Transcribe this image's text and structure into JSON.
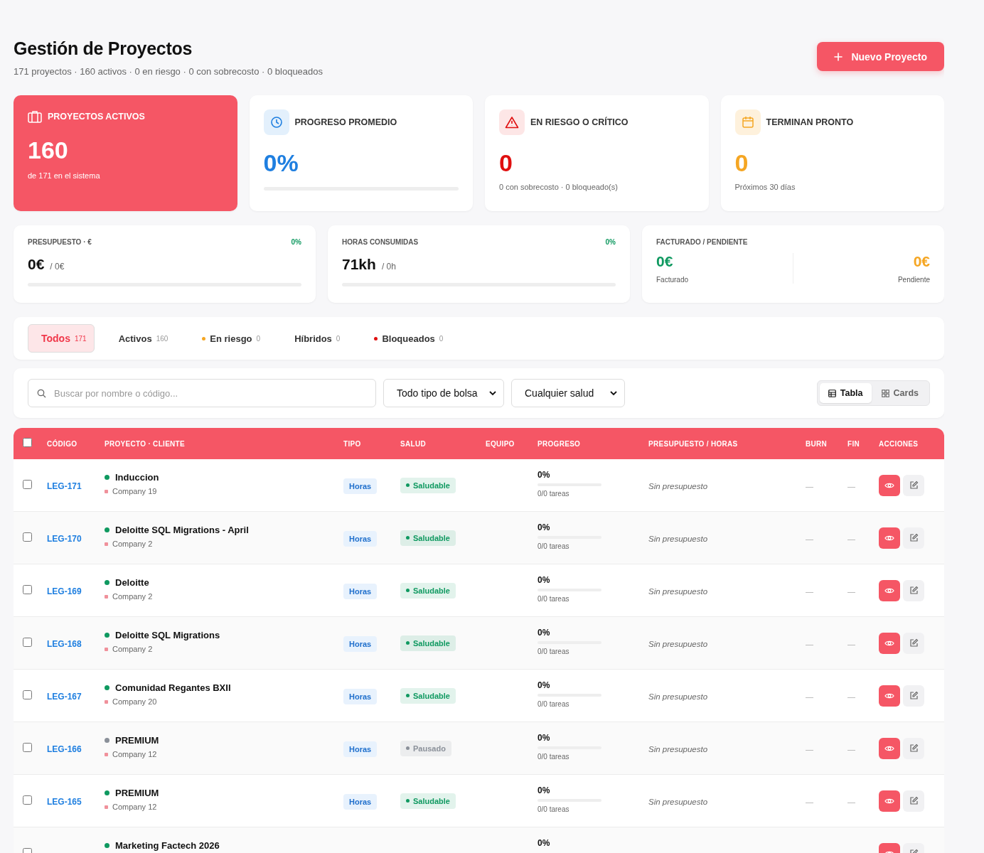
{
  "header": {
    "title": "Gestión de Proyectos",
    "subtitle": "171 proyectos · 160 activos · 0 en riesgo · 0 con sobrecosto · 0 bloqueados",
    "new_button": "Nuevo Proyecto"
  },
  "stat_cards": [
    {
      "kind": "primary",
      "label": "PROYECTOS ACTIVOS",
      "value": "160",
      "note": "de 171 en el sistema"
    },
    {
      "kind": "progress",
      "label": "PROGRESO PROMEDIO",
      "value": "0%",
      "level": 0
    },
    {
      "kind": "danger",
      "label": "EN RIESGO O CRÍTICO",
      "value": "0",
      "note": "0 con sobrecosto · 0 bloqueado(s)"
    },
    {
      "kind": "warning",
      "label": "TERMINAN PRONTO",
      "value": "0",
      "note": "Próximos 30 días"
    }
  ],
  "budget_cards": [
    {
      "kind": "meter",
      "label": "PRESUPUESTO · €",
      "percent": "0%",
      "value": "0€",
      "total": "/ 0€",
      "level": 0
    },
    {
      "kind": "meter",
      "label": "HORAS CONSUMIDAS",
      "percent": "0%",
      "value": "71kh",
      "total": "/ 0h",
      "level": 0
    },
    {
      "kind": "split",
      "label": "FACTURADO / PENDIENTE",
      "left_value": "0€",
      "left_label": "Facturado",
      "right_value": "0€",
      "right_label": "Pendiente"
    }
  ],
  "filter_tabs": [
    {
      "label": "Todos",
      "count": "171",
      "selected": true
    },
    {
      "label": "Activos",
      "count": "160",
      "selected": false
    },
    {
      "label": "En riesgo",
      "count": "0",
      "selected": false,
      "color": "#f5a623"
    },
    {
      "label": "Híbridos",
      "count": "0",
      "selected": false
    },
    {
      "label": "Bloqueados",
      "count": "0",
      "selected": false,
      "color": "#e01010"
    }
  ],
  "search": {
    "placeholder": "Buscar por nombre o código..."
  },
  "selects": [
    "Todo tipo de bolsa",
    "Cualquier salud"
  ],
  "view_toggle": [
    {
      "label": "Tabla",
      "selected": true
    },
    {
      "label": "Cards",
      "selected": false
    }
  ],
  "table": {
    "select_all_checked": false,
    "columns": [
      "CÓDIGO",
      "PROYECTO · CLIENTE",
      "TIPO",
      "SALUD",
      "EQUIPO",
      "PROGRESO",
      "PRESUPUESTO / HORAS",
      "BURN",
      "FIN",
      "ACCIONES"
    ],
    "rows": [
      {
        "checked": false,
        "code": "LEG-171",
        "name": "Induccion",
        "client": "Company 19",
        "type": "Horas",
        "health": "Saludable",
        "color": "#0f9960",
        "progress": "0%",
        "level": 0,
        "tasks": "0/0 tareas",
        "budget": "Sin presupuesto",
        "burn": "—",
        "end": "—"
      },
      {
        "checked": false,
        "code": "LEG-170",
        "name": "Deloitte SQL Migrations - April",
        "client": "Company 2",
        "type": "Horas",
        "health": "Saludable",
        "color": "#0f9960",
        "progress": "0%",
        "level": 0,
        "tasks": "0/0 tareas",
        "budget": "Sin presupuesto",
        "burn": "—",
        "end": "—"
      },
      {
        "checked": false,
        "code": "LEG-169",
        "name": "Deloitte",
        "client": "Company 2",
        "type": "Horas",
        "health": "Saludable",
        "color": "#0f9960",
        "progress": "0%",
        "level": 0,
        "tasks": "0/0 tareas",
        "budget": "Sin presupuesto",
        "burn": "—",
        "end": "—"
      },
      {
        "checked": false,
        "code": "LEG-168",
        "name": "Deloitte SQL Migrations",
        "client": "Company 2",
        "type": "Horas",
        "health": "Saludable",
        "color": "#0f9960",
        "progress": "0%",
        "level": 0,
        "tasks": "0/0 tareas",
        "budget": "Sin presupuesto",
        "burn": "—",
        "end": "—"
      },
      {
        "checked": false,
        "code": "LEG-167",
        "name": "Comunidad Regantes BXII",
        "client": "Company 20",
        "type": "Horas",
        "health": "Saludable",
        "color": "#0f9960",
        "progress": "0%",
        "level": 0,
        "tasks": "0/0 tareas",
        "budget": "Sin presupuesto",
        "burn": "—",
        "end": "—"
      },
      {
        "checked": false,
        "code": "LEG-166",
        "name": "PREMIUM",
        "client": "Company 12",
        "type": "Horas",
        "health": "Pausado",
        "color": "#8a9099",
        "progress": "0%",
        "level": 0,
        "tasks": "0/0 tareas",
        "budget": "Sin presupuesto",
        "burn": "—",
        "end": "—"
      },
      {
        "checked": false,
        "code": "LEG-165",
        "name": "PREMIUM",
        "client": "Company 12",
        "type": "Horas",
        "health": "Saludable",
        "color": "#0f9960",
        "progress": "0%",
        "level": 0,
        "tasks": "0/0 tareas",
        "budget": "Sin presupuesto",
        "burn": "—",
        "end": "—"
      },
      {
        "checked": false,
        "name": "Marketing Factech 2026",
        "color": "#0f9960",
        "progress": "0%"
      }
    ]
  }
}
